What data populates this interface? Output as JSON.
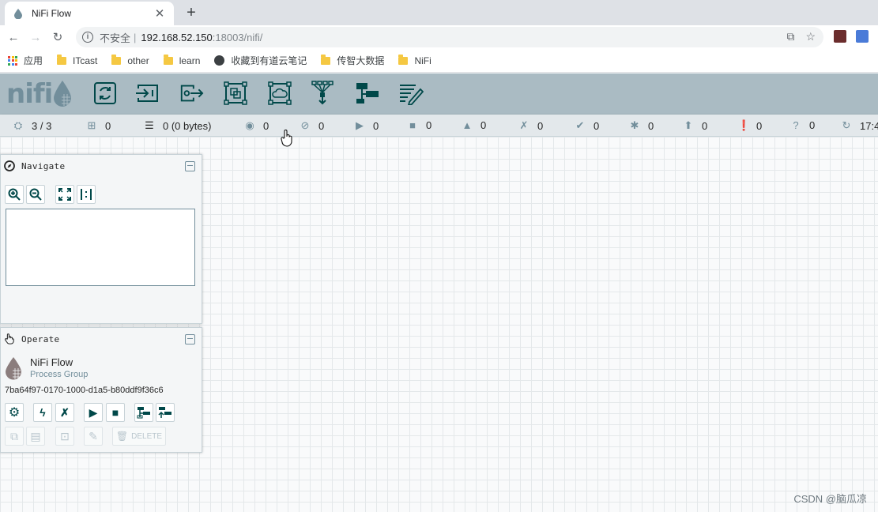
{
  "browser": {
    "tab_title": "NiFi Flow",
    "url_insecure_label": "不安全",
    "url_separator": "|",
    "url_host": "192.168.52.150",
    "url_path": ":18003/nifi/",
    "bookmarks": [
      "应用",
      "ITcast",
      "other",
      "learn",
      "收藏到有道云笔记",
      "传智大数据",
      "NiFi"
    ]
  },
  "nifi": {
    "logo_text": "nifi",
    "toolbar": [
      "processor",
      "input-port",
      "output-port",
      "process-group",
      "remote-process-group",
      "funnel",
      "template",
      "label"
    ],
    "status": {
      "cluster": "3 / 3",
      "threads": "0",
      "queued": "0 (0 bytes)",
      "transmitting": "0",
      "not_transmitting": "0",
      "running": "0",
      "stopped": "0",
      "invalid": "0",
      "disabled": "0",
      "up_to_date": "0",
      "locally_modified": "0",
      "stale": "0",
      "locally_modified_stale": "0",
      "sync_failure": "0",
      "last_refreshed": "17:4"
    },
    "navigate": {
      "title": "Navigate"
    },
    "operate": {
      "title": "Operate",
      "component_name": "NiFi Flow",
      "component_type": "Process Group",
      "component_id": "7ba64f97-0170-1000-d1a5-b80ddf9f36c6",
      "delete_label": "DELETE"
    }
  },
  "watermark": "CSDN @脑瓜凉",
  "colors": {
    "header_bg": "#aabbc3",
    "icon_dark": "#004849",
    "icon_muted": "#728e9b",
    "statusbar_bg": "#e3e8eb"
  }
}
